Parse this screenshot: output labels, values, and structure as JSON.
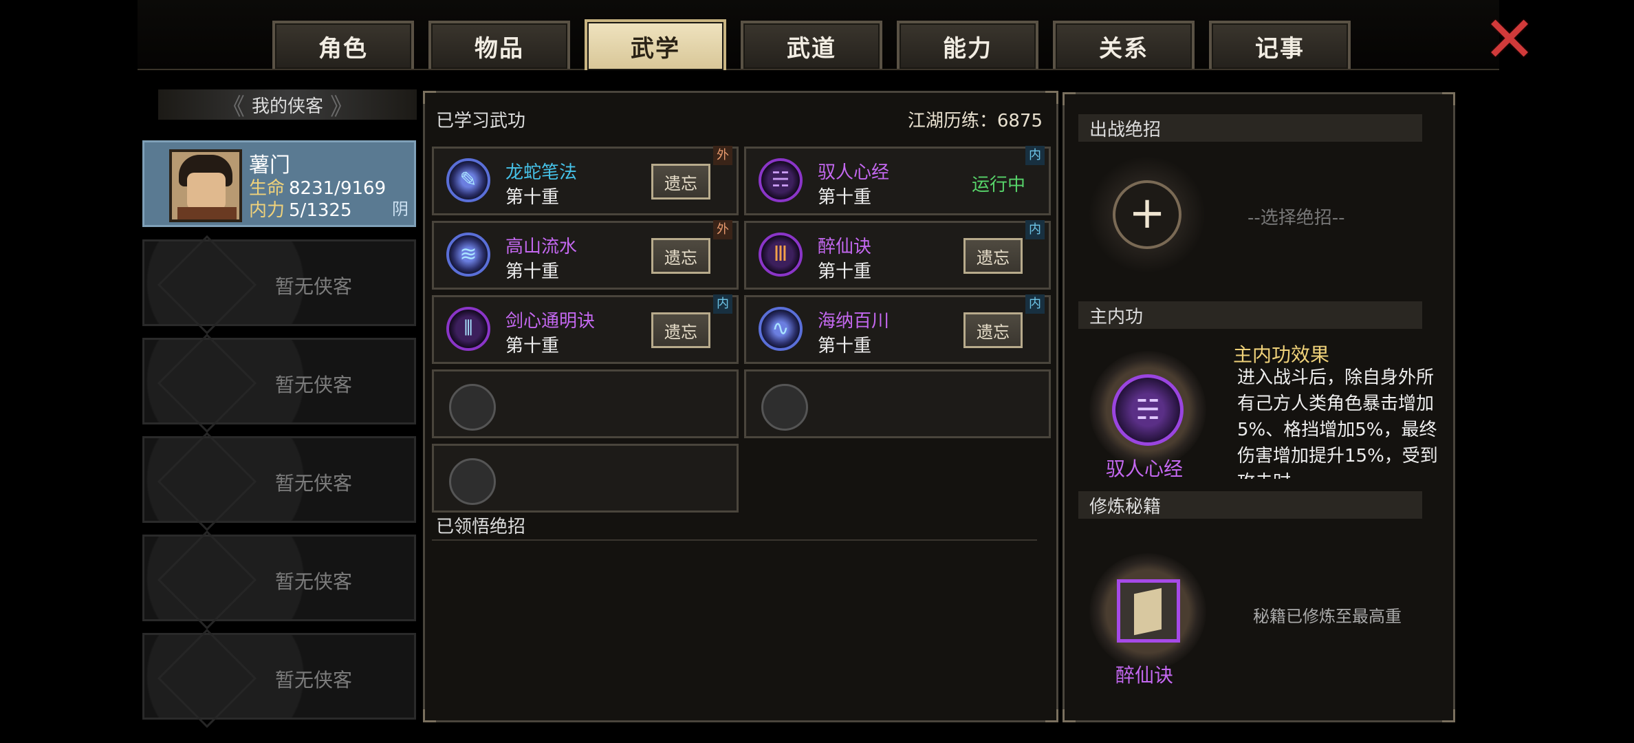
{
  "tabs": [
    "角色",
    "物品",
    "武学",
    "武道",
    "能力",
    "关系",
    "记事"
  ],
  "active_tab": "武学",
  "roster": {
    "header": "我的侠客",
    "active": {
      "name": "薯门",
      "hp_label": "生命",
      "hp_value": "8231/9169",
      "mp_label": "内力",
      "mp_value": "5/1325",
      "affinity": "阴"
    },
    "empty_slot_label": "暂无侠客",
    "empty_slots": 5
  },
  "center": {
    "learned_title": "已学习武功",
    "experience": "江湖历练：6875",
    "skills": [
      {
        "name": "龙蛇笔法",
        "level": "第十重",
        "action": "遗忘",
        "tag": "外",
        "color": "cyan"
      },
      {
        "name": "驭人心经",
        "level": "第十重",
        "status": "运行中",
        "tag": "内",
        "color": "purple"
      },
      {
        "name": "高山流水",
        "level": "第十重",
        "action": "遗忘",
        "tag": "外",
        "color": "purple"
      },
      {
        "name": "醉仙诀",
        "level": "第十重",
        "action": "遗忘",
        "tag": "内",
        "color": "purple"
      },
      {
        "name": "剑心通明诀",
        "level": "第十重",
        "action": "遗忘",
        "tag": "内",
        "color": "purple"
      },
      {
        "name": "海纳百川",
        "level": "第十重",
        "action": "遗忘",
        "tag": "内",
        "color": "purple"
      }
    ],
    "ultimates_title": "已领悟绝招"
  },
  "right": {
    "battle_title": "出战绝招",
    "choose_placeholder": "--选择绝招--",
    "main_inner_title": "主内功",
    "main_inner_name": "驭人心经",
    "effect_title": "主内功效果",
    "effect_text": "进入战斗后，除自身外所有己方人类角色暴击增加5%、格挡增加5%，最终伤害增加提升15%，受到攻击时",
    "training_title": "修炼秘籍",
    "training_book": "醉仙诀",
    "training_status": "秘籍已修炼至最高重"
  },
  "colors": {
    "active_tab_bg": "#e4d6ab",
    "active_slot_bg": "#5a7a92",
    "close_red": "#d13a3a",
    "skill_cyan": "#46c2e8",
    "skill_purple": "#c468f0",
    "running_green": "#57d46a",
    "stat_gold": "#f0d27a"
  },
  "icons": {
    "close": "close-x-icon",
    "add": "plus-icon"
  }
}
